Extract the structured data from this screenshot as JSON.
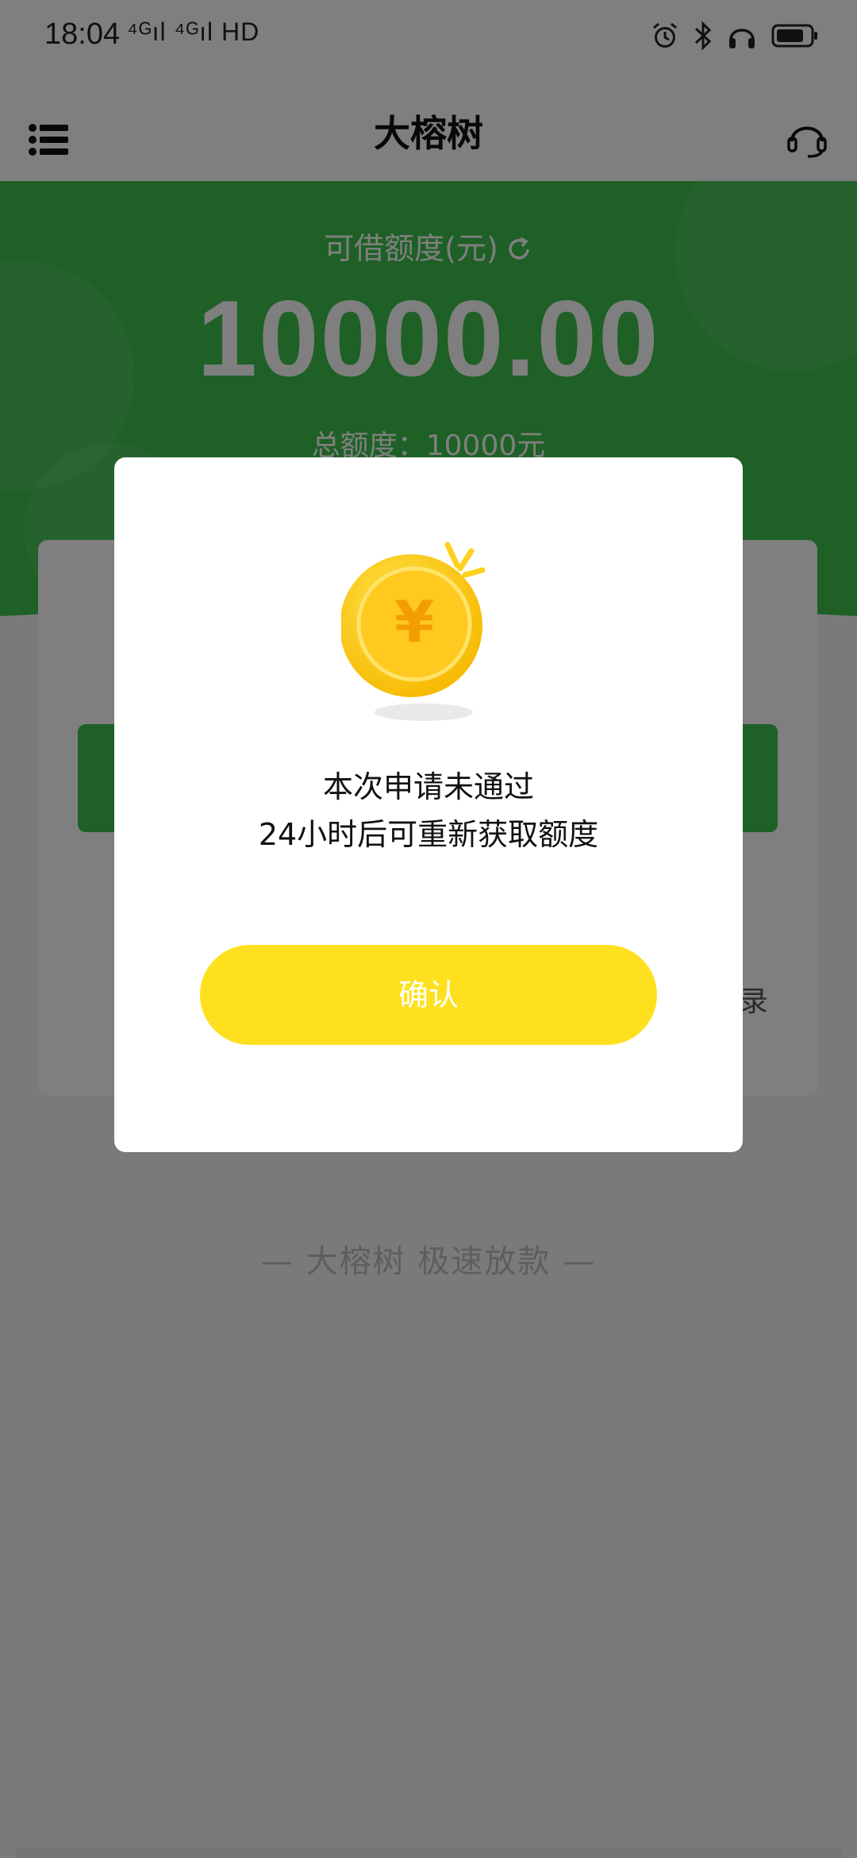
{
  "status_bar": {
    "time": "18:04",
    "network": "⁴ᴳıl ⁴ᴳıl HD",
    "icons": [
      "alarm-icon",
      "bluetooth-icon",
      "headphones-icon",
      "battery-icon"
    ]
  },
  "header": {
    "title": "大榕树",
    "menu_icon": "menu-list-icon",
    "support_icon": "customer-service-icon"
  },
  "hero": {
    "available_label": "可借额度(元)",
    "amount": "10000.00",
    "total_label": "总额度：10000元",
    "refresh_icon": "refresh-icon"
  },
  "card": {
    "records_partial": "录"
  },
  "footer": {
    "slogan": "— 大榕树  极速放款 —"
  },
  "dialog": {
    "icon": "yuan-coin-icon",
    "line1": "本次申请未通过",
    "line2": "24小时后可重新获取额度",
    "confirm_label": "确认"
  },
  "colors": {
    "brand_green": "#3cc04c",
    "confirm_yellow": "#ffe01e",
    "overlay": "rgba(0,0,0,0.5)"
  }
}
